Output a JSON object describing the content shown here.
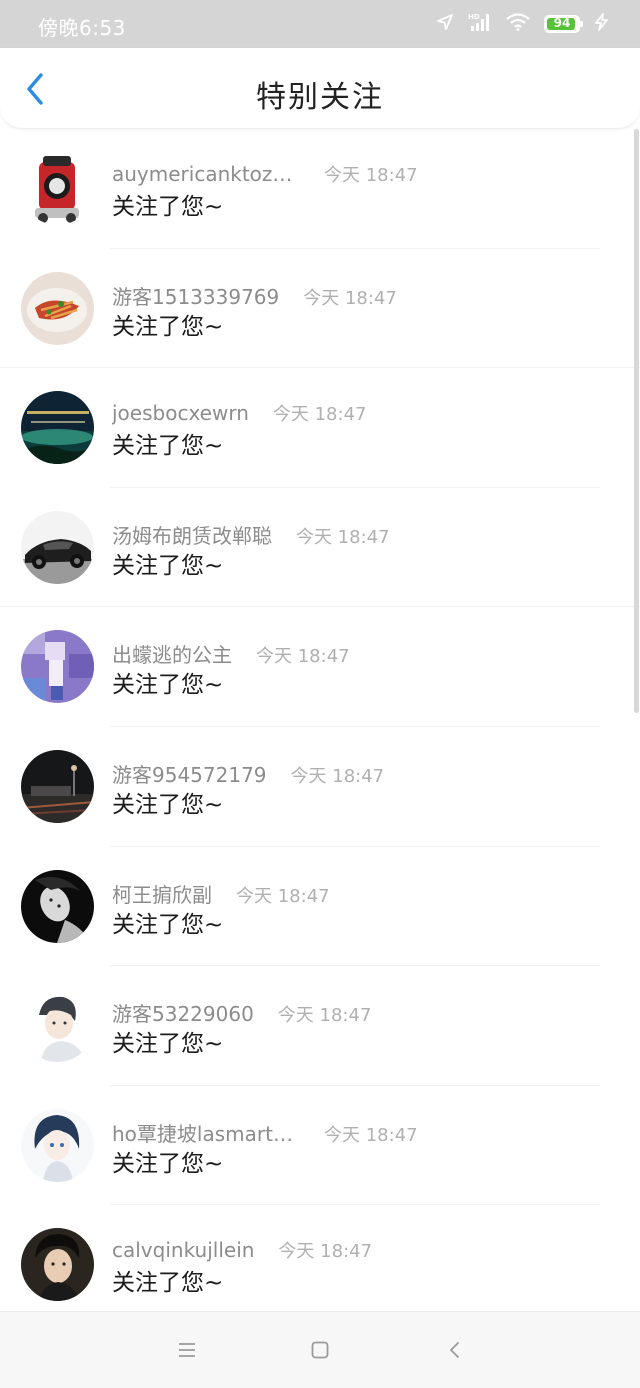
{
  "status_bar": {
    "time": "傍晚6:53",
    "battery": "94",
    "battery_level": 0.94,
    "icons": [
      "location-arrow-icon",
      "hd-signal-icon",
      "wifi-icon",
      "battery-icon",
      "charging-icon"
    ],
    "background": "#d5d5d5",
    "battery_color": "#58c23a"
  },
  "header": {
    "title": "特别关注",
    "back_icon": "chevron-left-icon",
    "accent": "#2b8ce5"
  },
  "list": {
    "items": [
      {
        "username": "auymericanktozuri…",
        "time": "今天 18:47",
        "message": "关注了您~",
        "avatar": "red-car-toy"
      },
      {
        "username": "游客1513339769",
        "time": "今天 18:47",
        "message": "关注了您~",
        "avatar": "food-plate"
      },
      {
        "username": "joesbocxewrn",
        "time": "今天 18:47",
        "message": "关注了您~",
        "avatar": "night-landscape"
      },
      {
        "username": "汤姆布朗赁改郸聪",
        "time": "今天 18:47",
        "message": "关注了您~",
        "avatar": "black-sports-car"
      },
      {
        "username": "出蠓逃的公主",
        "time": "今天 18:47",
        "message": "关注了您~",
        "avatar": "purple-girl"
      },
      {
        "username": "游客954572179",
        "time": "今天 18:47",
        "message": "关注了您~",
        "avatar": "night-street"
      },
      {
        "username": "柯王掮欣副",
        "time": "今天 18:47",
        "message": "关注了您~",
        "avatar": "bw-portrait"
      },
      {
        "username": "游客53229060",
        "time": "今天 18:47",
        "message": "关注了您~",
        "avatar": "anime-boy"
      },
      {
        "username": "ho覃捷坡lasmart智…",
        "time": "今天 18:47",
        "message": "关注了您~",
        "avatar": "anime-girl"
      },
      {
        "username": "calvqinkujllein",
        "time": "今天 18:47",
        "message": "关注了您~",
        "avatar": "young-man"
      }
    ]
  },
  "bottom_nav": {
    "icons": [
      "menu-icon",
      "home-icon",
      "back-icon"
    ]
  }
}
